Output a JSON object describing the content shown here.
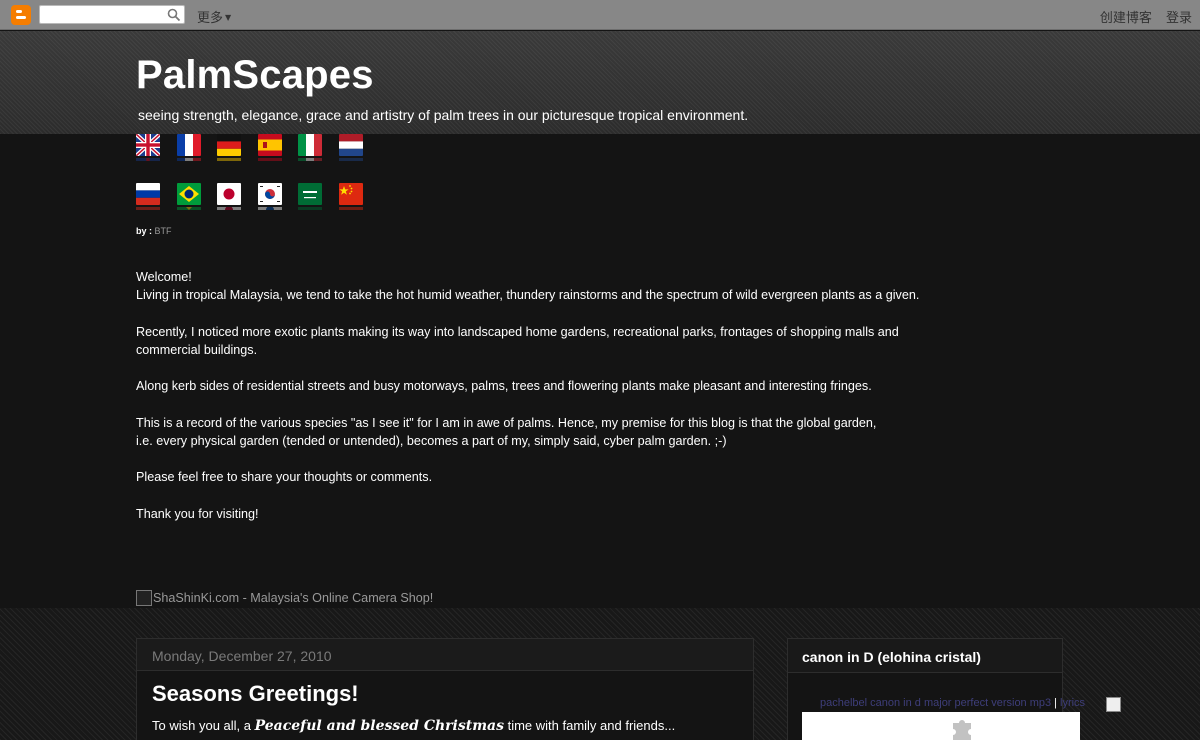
{
  "navbar": {
    "logo_icon": "blogger-logo-icon",
    "search_placeholder": "",
    "more_label": "更多",
    "create_blog_label": "创建博客",
    "login_label": "登录"
  },
  "header": {
    "title": "PalmScapes",
    "description": "seeing strength, elegance, grace and artistry of palm trees in our picturesque tropical environment."
  },
  "flags": {
    "row1": [
      "uk-flag-icon",
      "france-flag-icon",
      "germany-flag-icon",
      "spain-flag-icon",
      "italy-flag-icon",
      "netherlands-flag-icon"
    ],
    "row2": [
      "russia-flag-icon",
      "brazil-flag-icon",
      "japan-flag-icon",
      "korea-flag-icon",
      "saudi-arabia-flag-icon",
      "china-flag-icon"
    ]
  },
  "byline": {
    "prefix": "by :",
    "author": "BTF"
  },
  "intro": {
    "p1_line1": "Welcome!",
    "p1_line2": "Living in tropical Malaysia, we tend to take the hot humid weather, thundery rainstorms and the spectrum of wild evergreen plants as a given.",
    "p2_line1": "Recently, I noticed more exotic plants making its way into landscaped home gardens, recreational parks, frontages of shopping malls and",
    "p2_line2": "commercial buildings.",
    "p3": "Along kerb sides of residential streets and busy motorways, palms, trees and flowering plants make pleasant and interesting fringes.",
    "p4_line1": "This is a record of the various species \"as I see it\" for I am in awe of palms. Hence, my premise for this blog is that the global garden,",
    "p4_line2": "i.e. every physical garden (tended or untended), becomes a part of my, simply said, cyber palm garden. ;-)",
    "p5": "Please feel free to share your thoughts or comments.",
    "p6": "Thank you for visiting!"
  },
  "shop_link": {
    "text": "ShaShinKi.com - Malaysia's Online Camera Shop!"
  },
  "post": {
    "date": "Monday, December 27, 2010",
    "title": "Seasons Greetings!",
    "body_prefix": "To wish you all, a ",
    "body_emphasis": "Peaceful and blessed Christmas",
    "body_suffix": " time with family and friends..."
  },
  "sidebar": {
    "widget_title": "canon in D (elohina cristal)",
    "link1": "pachelbel canon in d major perfect version mp3",
    "separator": "|",
    "link2": "lyrics",
    "plugin_icon": "puzzle-plugin-icon"
  }
}
